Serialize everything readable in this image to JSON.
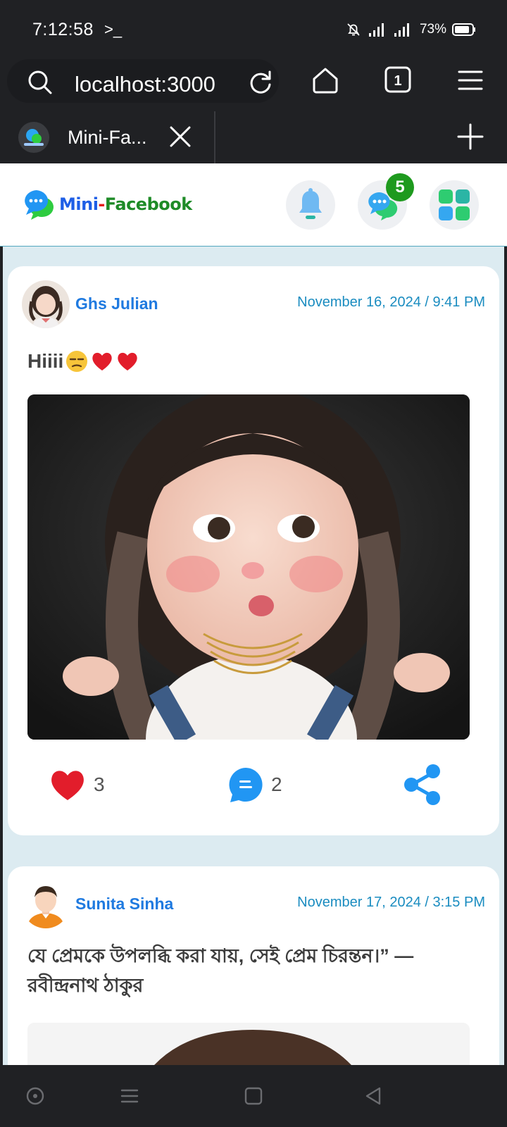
{
  "status_bar": {
    "time": "7:12:58",
    "terminal_glyph": ">_",
    "battery": "73%"
  },
  "browser": {
    "url": "localhost:3000",
    "tab_count": "1",
    "tab_title": "Mini-Fa..."
  },
  "app": {
    "logo_mini": "Mini",
    "logo_dash": "-",
    "logo_facebook": "Facebook",
    "messages_badge": "5"
  },
  "posts": [
    {
      "author": "Ghs Julian",
      "date": "November 16, 2024 / 9:41 PM",
      "text": "Hiiii",
      "emojis": [
        "unamused-face",
        "red-heart",
        "red-heart"
      ],
      "likes": "3",
      "comments": "2"
    },
    {
      "author": "Sunita Sinha",
      "date": "November 17, 2024 / 3:15 PM",
      "text": "যে প্রেমকে উপলব্ধি করা যায়, সেই প্রেম চিরন্তন।” — রবীন্দ্রনাথ ঠাকুর"
    }
  ],
  "icons": {
    "heart_color": "#e21d2b",
    "comment_color": "#2196f3",
    "share_color": "#2196f3",
    "author_color": "#1f7ae0",
    "date_color": "#1a8cc0"
  }
}
